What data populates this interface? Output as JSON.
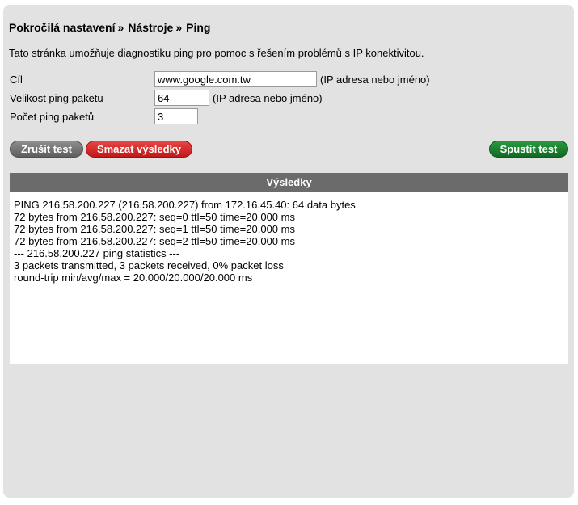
{
  "breadcrumb": {
    "items": [
      "Pokročilá nastavení",
      "Nástroje",
      "Ping"
    ],
    "separator": "»"
  },
  "description": "Tato stránka umožňuje diagnostiku ping pro pomoc s řešením problémů s IP konektivitou.",
  "form": {
    "target": {
      "label": "Cíl",
      "value": "www.google.com.tw",
      "hint": "(IP adresa nebo jméno)"
    },
    "packet_size": {
      "label": "Velikost ping paketu",
      "value": "64",
      "hint": "(IP adresa nebo jméno)"
    },
    "packet_count": {
      "label": "Počet ping paketů",
      "value": "3"
    }
  },
  "buttons": {
    "cancel": "Zrušit test",
    "clear": "Smazat výsledky",
    "start": "Spustit test"
  },
  "results": {
    "title": "Výsledky",
    "lines": [
      "PING 216.58.200.227 (216.58.200.227) from 172.16.45.40: 64 data bytes",
      "72 bytes from 216.58.200.227: seq=0 ttl=50 time=20.000 ms",
      "72 bytes from 216.58.200.227: seq=1 ttl=50 time=20.000 ms",
      "72 bytes from 216.58.200.227: seq=2 ttl=50 time=20.000 ms",
      "--- 216.58.200.227 ping statistics ---",
      "3 packets transmitted, 3 packets received, 0% packet loss",
      "round-trip min/avg/max = 20.000/20.000/20.000 ms"
    ]
  },
  "colors": {
    "panel_bg": "#e2e2e2",
    "results_header_bg": "#6b6b6b",
    "cancel_button": "#6e6e6e",
    "clear_button": "#d42a2a",
    "start_button": "#1c7f2f"
  }
}
